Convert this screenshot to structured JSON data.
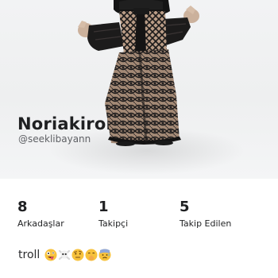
{
  "profile": {
    "display_name": "Noriakiroha",
    "username": "@seeklibayann",
    "bio_text": "troll",
    "bio_emojis": [
      "zany-face-emoji",
      "skull-crossbones-emoji",
      "raised-eyebrow-face-emoji",
      "shushing-face-emoji",
      "anxious-sweat-face-emoji"
    ]
  },
  "stats": [
    {
      "value": "8",
      "label": "Arkadaşlar"
    },
    {
      "value": "1",
      "label": "Takipçi"
    },
    {
      "value": "5",
      "label": "Takip Edilen"
    }
  ]
}
